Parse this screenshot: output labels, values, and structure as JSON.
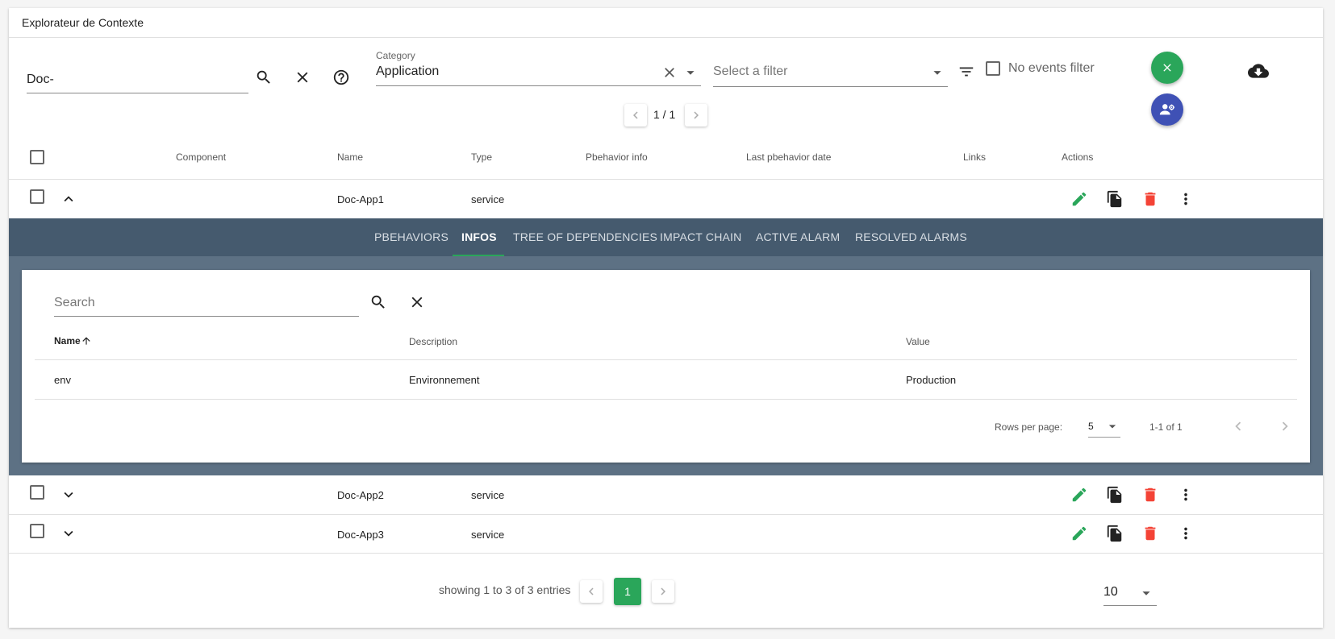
{
  "header": {
    "title": "Explorateur de Contexte"
  },
  "search": {
    "value": "Doc-"
  },
  "category": {
    "label": "Category",
    "value": "Application"
  },
  "filter": {
    "placeholder": "Select a filter"
  },
  "no_events_filter": {
    "label": "No events filter"
  },
  "top_pager": {
    "text": "1 / 1"
  },
  "table": {
    "headers": {
      "component": "Component",
      "name": "Name",
      "type": "Type",
      "pbehavior_info": "Pbehavior info",
      "last_pbehavior_date": "Last pbehavior date",
      "links": "Links",
      "actions": "Actions"
    },
    "rows": [
      {
        "name": "Doc-App1",
        "type": "service"
      },
      {
        "name": "Doc-App2",
        "type": "service"
      },
      {
        "name": "Doc-App3",
        "type": "service"
      }
    ]
  },
  "tabs": [
    "PBEHAVIORS",
    "INFOS",
    "TREE OF DEPENDENCIES",
    "IMPACT CHAIN",
    "ACTIVE ALARM",
    "RESOLVED ALARMS"
  ],
  "infos": {
    "search_placeholder": "Search",
    "headers": {
      "name": "Name",
      "description": "Description",
      "value": "Value"
    },
    "rows": [
      {
        "name": "env",
        "description": "Environnement",
        "value": "Production"
      }
    ],
    "rows_per_page_label": "Rows per page:",
    "rows_per_page_value": "5",
    "range_text": "1-1 of 1"
  },
  "footer": {
    "showing_text": "showing 1 to 3 of 3 entries",
    "current_page": "1",
    "per_page_value": "10"
  },
  "colors": {
    "accent_green": "#2aa65a",
    "delete_red": "#f44336",
    "fab_indigo": "#3f51b5",
    "tabs_bg": "#455a6e"
  }
}
